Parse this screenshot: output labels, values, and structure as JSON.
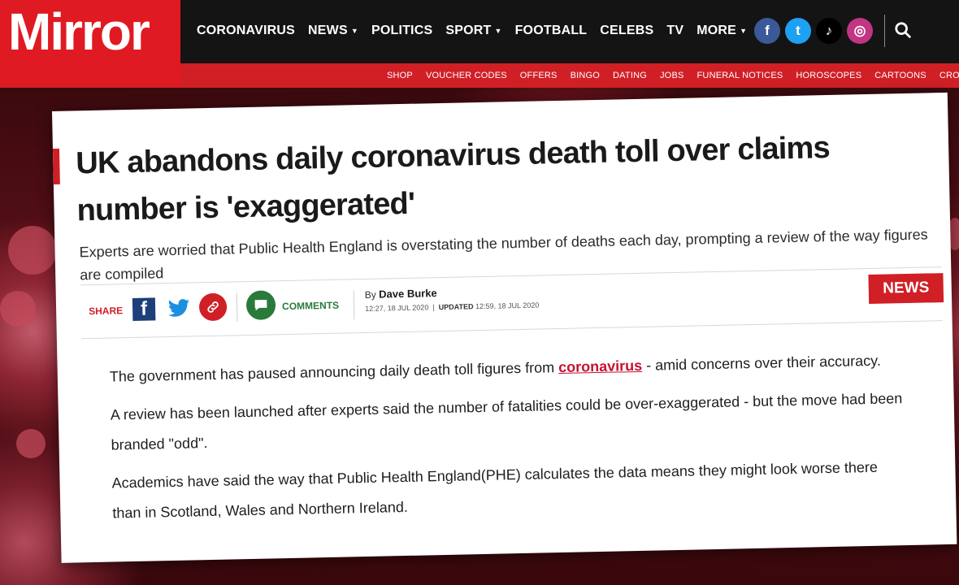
{
  "brand": {
    "logo": "Mirror",
    "accent_color": "#e01a22"
  },
  "nav": {
    "items": [
      {
        "label": "CORONAVIRUS",
        "dropdown": false
      },
      {
        "label": "NEWS",
        "dropdown": true
      },
      {
        "label": "POLITICS",
        "dropdown": false
      },
      {
        "label": "SPORT",
        "dropdown": true
      },
      {
        "label": "FOOTBALL",
        "dropdown": false
      },
      {
        "label": "CELEBS",
        "dropdown": false
      },
      {
        "label": "TV",
        "dropdown": false
      },
      {
        "label": "MORE",
        "dropdown": true
      }
    ],
    "social": [
      {
        "name": "facebook-icon",
        "glyph": "f",
        "color": "#3b5998"
      },
      {
        "name": "twitter-icon",
        "glyph": "t",
        "color": "#1da1f2"
      },
      {
        "name": "tiktok-icon",
        "glyph": "♪",
        "color": "#000000"
      },
      {
        "name": "instagram-icon",
        "glyph": "◎",
        "color": "#c13584"
      }
    ]
  },
  "subnav": {
    "items": [
      "SHOP",
      "VOUCHER CODES",
      "OFFERS",
      "BINGO",
      "DATING",
      "JOBS",
      "FUNERAL NOTICES",
      "HOROSCOPES",
      "CARTOONS",
      "CROS"
    ]
  },
  "article": {
    "headline": "UK abandons daily coronavirus death toll over claims number is 'exaggerated'",
    "subhead": "Experts are worried that Public Health England is overstating the number of deaths each day, prompting a review of the way figures are compiled",
    "share_label": "SHARE",
    "comments_label": "COMMENTS",
    "byline_prefix": "By",
    "author": "Dave Burke",
    "published": "12:27, 18 JUL 2020",
    "updated_label": "UPDATED",
    "updated": "12:59, 18 JUL 2020",
    "section_badge": "NEWS",
    "paragraphs": [
      {
        "before": "The government has paused announcing daily death toll figures from ",
        "link": "coronavirus",
        "after": " - amid concerns over their accuracy."
      },
      {
        "text": "A review has been launched after experts said the number of fatalities could be over-exaggerated - but the move had been branded \"odd\"."
      },
      {
        "text": "Academics have said the way that Public Health England(PHE) calculates the data means they might look worse there than in Scotland, Wales and Northern Ireland."
      }
    ]
  }
}
